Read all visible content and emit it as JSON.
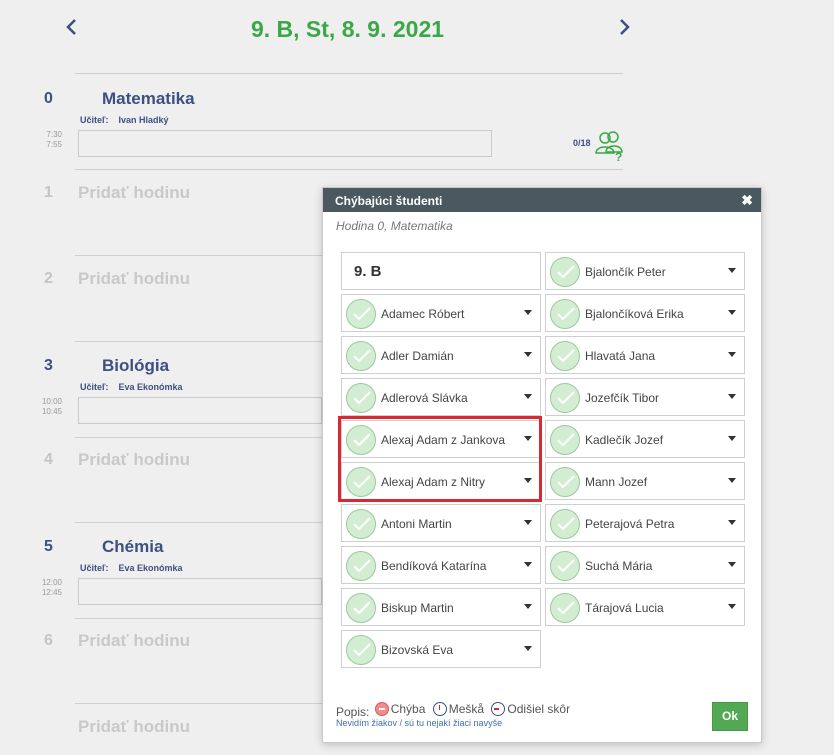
{
  "header": {
    "title": "9. B, St, 8. 9. 2021",
    "prev_icon": "chevron-left-icon",
    "next_icon": "chevron-right-icon"
  },
  "lessons": [
    {
      "number": "0",
      "subject": "Matematika",
      "teacher_label": "Učiteľ:",
      "teacher": "Ivan Hladký",
      "time_start": "7:30",
      "time_end": "7:55",
      "count": "0/18"
    },
    {
      "number": "1",
      "add_label": "Pridať hodinu"
    },
    {
      "number": "2",
      "add_label": "Pridať hodinu"
    },
    {
      "number": "3",
      "subject": "Biológia",
      "teacher_label": "Učiteľ:",
      "teacher": "Eva Ekonómka",
      "time_start": "10:00",
      "time_end": "10:45"
    },
    {
      "number": "4",
      "add_label": "Pridať hodinu"
    },
    {
      "number": "5",
      "subject": "Chémia",
      "teacher_label": "Učiteľ:",
      "teacher": "Eva Ekonómka",
      "time_start": "12:00",
      "time_end": "12:45"
    },
    {
      "number": "6",
      "add_label": "Pridať hodinu"
    },
    {
      "number": "",
      "add_label": "Pridať hodinu"
    }
  ],
  "modal": {
    "title": "Chýbajúci študenti",
    "close_icon": "close-icon",
    "subtitle": "Hodina 0, Matematika",
    "class_name": "9. B",
    "left_students": [
      "Adamec Róbert",
      "Adler Damián",
      "Adlerová Slávka",
      "Alexaj Adam z Jankova",
      "Alexaj Adam z Nitry",
      "Antoni Martin",
      "Bendíková Katarína",
      "Biskup Martin",
      "Bizovská Eva"
    ],
    "right_students": [
      "Bjalončík Peter",
      "Bjalončíková Erika",
      "Hlavatá Jana",
      "Jozefčík Tibor",
      "Kadlečík Jozef",
      "Mann Jozef",
      "Peterajová Petra",
      "Suchá Mária",
      "Tárajová Lucia"
    ],
    "legend": {
      "label": "Popis:",
      "error": "Chýba",
      "late": "Meškå",
      "leave": "Odišiel skôr"
    },
    "link": "Nevidím žiakov / sú tu nejakí žiaci navyše",
    "ok_label": "Ok"
  },
  "colors": {
    "accent_green": "#3aa847",
    "navy": "#3d4f83",
    "header_dark": "#4a5960",
    "highlight_red": "#d9282f"
  }
}
